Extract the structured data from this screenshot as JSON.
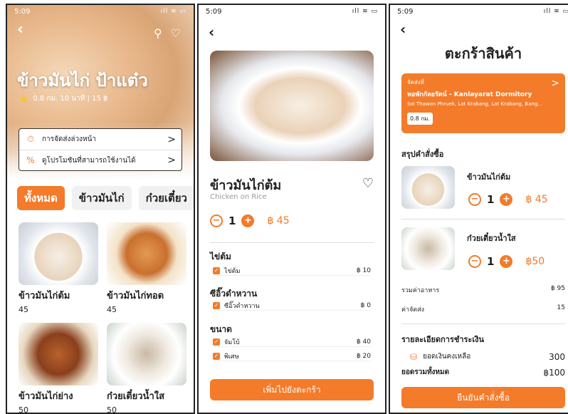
{
  "status": {
    "time": "5:09",
    "icons": "ıll ≋ ▭"
  },
  "screen1": {
    "back_icon": "‹",
    "search_icon": "⚲",
    "heart_icon": "♡",
    "shop_name": "ข้าวมันไก่ ป้าแต๋ว",
    "rating_star": "★",
    "meta": "0.8 กม. 10 นาที | 15 ฿",
    "promos": [
      {
        "icon": "⏱",
        "label": "การจัดส่งล่วงหน้า",
        "chevron": ">"
      },
      {
        "icon": "%",
        "label": "ดูโปรโมชันที่สามารถใช้งานได้",
        "chevron": ">"
      }
    ],
    "categories": [
      "ทั้งหมด",
      "ข้าวมันไก่",
      "ก๋วยเตี๋ยว"
    ],
    "menu": [
      {
        "name": "ข้าวมันไก่ต้ม",
        "price": "45"
      },
      {
        "name": "ข้าวมันไก่ทอด",
        "price": "45"
      },
      {
        "name": "ข้าวมันไก่ย่าง",
        "price": "50"
      },
      {
        "name": "ก๋วยเตี๋ยวน้ำใส",
        "price": "50"
      }
    ]
  },
  "screen2": {
    "back_icon": "‹",
    "title": "ข้าวมันไก่ต้ม",
    "subtitle": "Chicken on Rice",
    "heart_icon": "♡",
    "qty": "1",
    "minus": "−",
    "plus": "+",
    "price": "฿ 45",
    "options": [
      {
        "title": "ไข่ต้ม",
        "items": [
          {
            "label": "ไข่ต้ม",
            "price": "฿ 10"
          }
        ]
      },
      {
        "title": "ซีอิ๊วดำหวาน",
        "items": [
          {
            "label": "ซีอิ๊วดำหวาน",
            "price": "฿ 0"
          }
        ]
      },
      {
        "title": "ขนาด",
        "items": [
          {
            "label": "จัมโบ้",
            "price": "฿ 40"
          },
          {
            "label": "พิเศษ",
            "price": "฿ 20"
          }
        ]
      }
    ],
    "check": "✓",
    "cta": "เพิ่มไปยังตะกร้า"
  },
  "screen3": {
    "back_icon": "‹",
    "title": "ตะกร้าสินค้า",
    "address": {
      "label": "จัดส่งที่",
      "name": "หอพักกัลยรัตน์ - Kanlayarat Dormitory",
      "detail": "Soi Thawon Phruek, Lat Krabang, Lat Krabang, Bang...",
      "distance": "0.8 กม.",
      "chevron": ">"
    },
    "summary_title": "สรุปคำสั่งซื้อ",
    "items": [
      {
        "name": "ข้าวมันไก่ต้ม",
        "qty": "1",
        "price": "฿ 45"
      },
      {
        "name": "ก๋วยเตี๋ยวน้ำใส",
        "qty": "1",
        "price": "฿50"
      }
    ],
    "food_total_label": "รวมค่าอาหาร",
    "food_total": "฿ 95",
    "delivery_label": "ค่าจัดส่ง",
    "delivery": "15",
    "payment_title": "รายละเอียดการชำระเงิน",
    "coin_icon": "⛁",
    "balance_label": "ยอดเงินคงเหลือ",
    "balance": "300",
    "grand_label": "ยอดรวมทั้งหมด",
    "grand_total": "฿100",
    "cta": "ยืนยันคำสั่งซื้อ"
  }
}
